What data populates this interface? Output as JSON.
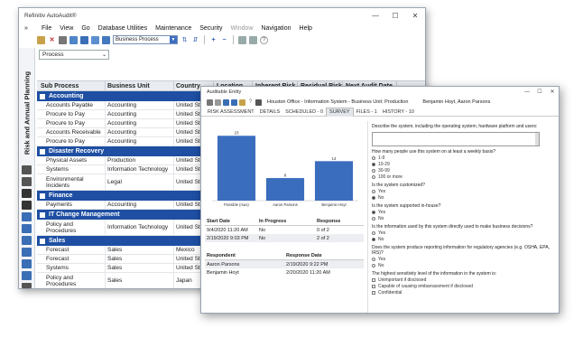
{
  "main_window": {
    "title": "Refinitiv AutoAudit®",
    "menu": [
      "File",
      "View",
      "Go",
      "Database Utilities",
      "Maintenance",
      "Security",
      "Window",
      "Navigation",
      "Help"
    ],
    "toolbar_dropdown": "Business Process",
    "side_title": "Risk and Annual Planning",
    "process_select": "Process",
    "columns": [
      "Sub Process",
      "Business Unit",
      "Country",
      "Location",
      "Inherent Risk",
      "Residual Risk",
      "Next Audit Date"
    ],
    "groups": [
      {
        "name": "Accounting",
        "rows": [
          [
            "Accounts Payable",
            "Accounting",
            "United Sta",
            "",
            "",
            "",
            ""
          ],
          [
            "Procure to Pay",
            "Accounting",
            "United Sta",
            "",
            "",
            "",
            ""
          ],
          [
            "Procure to Pay",
            "Accounting",
            "United Sta",
            "",
            "",
            "",
            ""
          ],
          [
            "Accounts Receivable",
            "Accounting",
            "United Sta",
            "",
            "",
            "",
            ""
          ],
          [
            "Procure to Pay",
            "Accounting",
            "United Sta",
            "",
            "",
            "",
            ""
          ]
        ]
      },
      {
        "name": "Disaster Recovery",
        "rows": [
          [
            "Physical Assets",
            "Production",
            "United Sta",
            "",
            "",
            "",
            ""
          ],
          [
            "Systems",
            "Information Technology",
            "United Sta",
            "",
            "",
            "",
            ""
          ],
          [
            "Environmental Incidents",
            "Legal",
            "United Sta",
            "",
            "",
            "",
            ""
          ]
        ]
      },
      {
        "name": "Finance",
        "rows": [
          [
            "Payments",
            "Accounting",
            "United Sta",
            "",
            "",
            "",
            ""
          ]
        ]
      },
      {
        "name": "IT Change Management",
        "rows": [
          [
            "Policy and Procedures",
            "Information Technology",
            "United Sta",
            "",
            "",
            "",
            ""
          ]
        ]
      },
      {
        "name": "Sales",
        "rows": [
          [
            "Forecast",
            "Sales",
            "Mexico",
            "",
            "",
            "",
            ""
          ],
          [
            "Forecast",
            "Sales",
            "United Sta",
            "",
            "",
            "",
            ""
          ],
          [
            "Systems",
            "Sales",
            "United Sta",
            "",
            "",
            "",
            ""
          ],
          [
            "Policy and Procedures",
            "Sales",
            "Japan",
            "",
            "",
            "",
            ""
          ]
        ]
      }
    ]
  },
  "entity_window": {
    "title": "Auditable Entity",
    "entity_name": "Houston Office - Information System - Business Unit: Production",
    "people": "Benjamin Hoyt, Aaron Parsons",
    "tabs": [
      "RISK ASSESSMENT",
      "DETAILS",
      "SCHEDULED - 0",
      "SURVEY",
      "FILES - 1",
      "HISTORY - 10"
    ],
    "active_tab": "SURVEY",
    "list1_headers": [
      "Start Date",
      "In Progress",
      "Response"
    ],
    "list1_rows": [
      [
        "9/4/2020 11:20 AM",
        "No",
        "0 of 2"
      ],
      [
        "2/19/2020 9:03 PM",
        "No",
        "2 of 2"
      ]
    ],
    "list2_headers": [
      "Respondent",
      "Response Date"
    ],
    "list2_rows": [
      [
        "Aaron Parsons",
        "2/19/2020 9:22 PM"
      ],
      [
        "Benjamin Hoyt",
        "2/20/2020 11:20 AM"
      ]
    ],
    "survey": {
      "q1": "Describe the system, including the operating system, hardware platform and users:",
      "q2": "How many people use this system on at least a weekly basis?",
      "q2_opts": [
        "1-9",
        "10-29",
        "30-99",
        "100 or more"
      ],
      "q2_sel": 1,
      "q3": "Is the system customized?",
      "q3_opts": [
        "Yes",
        "No"
      ],
      "q3_sel": 1,
      "q4": "Is the system supported in-house?",
      "q4_opts": [
        "Yes",
        "No"
      ],
      "q4_sel": 0,
      "q5": "Is the information used by this system directly used to make business decisions?",
      "q5_opts": [
        "Yes",
        "No"
      ],
      "q5_sel": 1,
      "q6": "Does the system produce reporting information for regulatory agencies (e.g. OSHA, EPA, IRS)?",
      "q6_opts": [
        "Yes",
        "No"
      ],
      "q6_sel": -1,
      "q7": "The highest sensitivity level of the information in the system is:",
      "q7_opts": [
        "Unimportant if disclosed",
        "Capable of causing embarrassment if disclosed",
        "Confidential"
      ]
    }
  },
  "chart_data": {
    "type": "bar",
    "categories": [
      "Possible (max)",
      "Aaron Parsons",
      "Benjamin Hoyt"
    ],
    "values": [
      23,
      8,
      14
    ],
    "ylim": [
      0,
      25
    ],
    "bar_color": "#3b6dbe"
  }
}
